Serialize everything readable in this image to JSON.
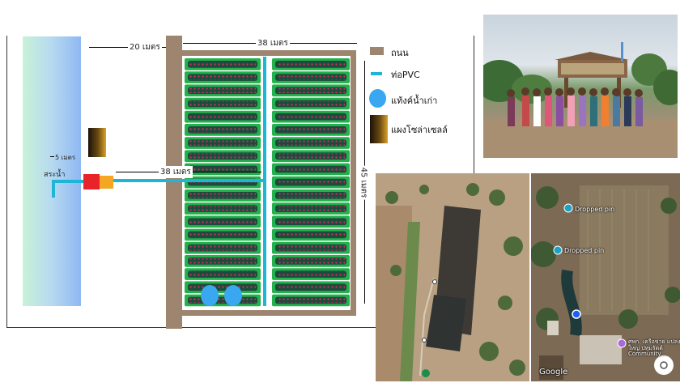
{
  "diagram": {
    "dim_top_left": "20 เมตร",
    "dim_top_right": "38 เมตร",
    "dim_middle": "38 เมตร",
    "dim_side": "45 เมตร",
    "dim_small": "5 เมตร",
    "water_source_label": "สระน้ำ"
  },
  "legend": {
    "road": "ถนน",
    "pvc": "ท่อPVC",
    "tank": "แท้งค์น้ำเก่า",
    "solar": "แผงโซล่าเซลล์"
  },
  "map": {
    "pin_1": "Dropped pin",
    "pin_2": "Dropped pin",
    "poi_line1": "ศพก. เครือข่าย แปลงใ",
    "poi_line2": "ใหญ่ ปทุมรัตต์",
    "poi_line3": "Community...",
    "brand": "Google"
  },
  "colors": {
    "road": "#9e8570",
    "pvc": "#1fb5d6",
    "bed_green": "#22b14c",
    "bed_dark": "#1d4a3c",
    "tank": "#3aa8f0"
  }
}
